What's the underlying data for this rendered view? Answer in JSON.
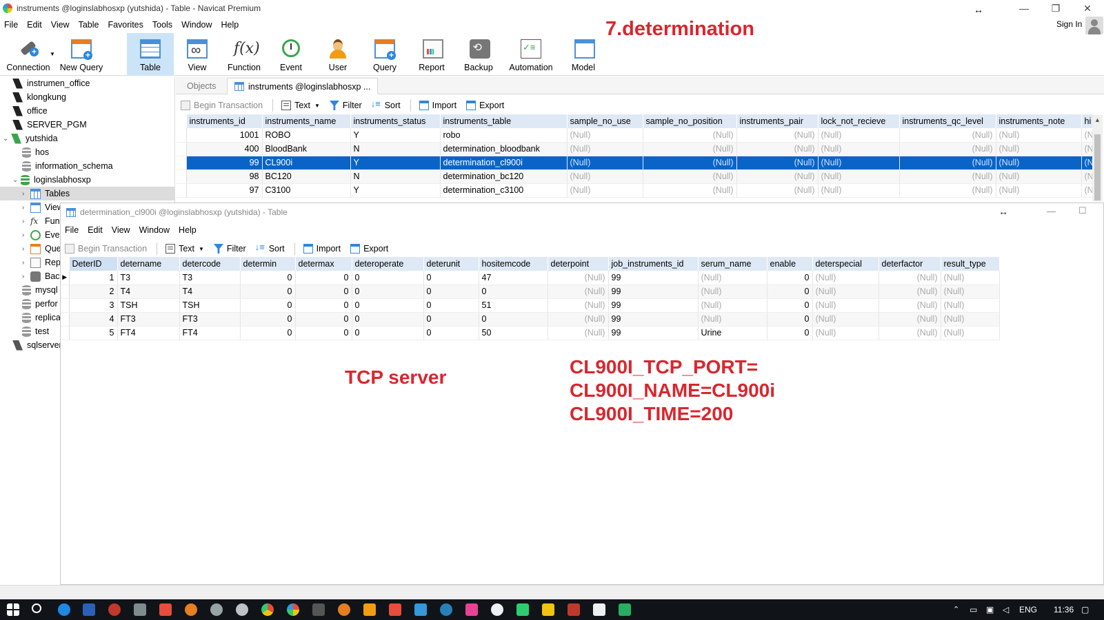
{
  "window": {
    "title": "instruments @loginslabhosxp (yutshida) - Table - Navicat Premium",
    "sign_in": "Sign In"
  },
  "menu": [
    "File",
    "Edit",
    "View",
    "Table",
    "Favorites",
    "Tools",
    "Window",
    "Help"
  ],
  "toolbar": {
    "items": [
      {
        "label": "Connection",
        "icon": "connection-icon"
      },
      {
        "label": "New Query",
        "icon": "new-query-icon"
      },
      {
        "label": "Table",
        "icon": "table-icon",
        "active": true
      },
      {
        "label": "View",
        "icon": "view-icon"
      },
      {
        "label": "Function",
        "icon": "function-icon"
      },
      {
        "label": "Event",
        "icon": "event-icon"
      },
      {
        "label": "User",
        "icon": "user-icon"
      },
      {
        "label": "Query",
        "icon": "query-icon"
      },
      {
        "label": "Report",
        "icon": "report-icon"
      },
      {
        "label": "Backup",
        "icon": "backup-icon"
      },
      {
        "label": "Automation",
        "icon": "automation-icon"
      },
      {
        "label": "Model",
        "icon": "model-icon"
      }
    ]
  },
  "sidebar": {
    "items": [
      {
        "label": "instrumen_office",
        "icon": "connection-icon"
      },
      {
        "label": "klongkung",
        "icon": "connection-icon"
      },
      {
        "label": "office",
        "icon": "connection-icon"
      },
      {
        "label": "SERVER_PGM",
        "icon": "connection-icon"
      },
      {
        "label": "yutshida",
        "icon": "connection-icon",
        "expanded": true
      },
      {
        "label": "hos",
        "icon": "database-icon"
      },
      {
        "label": "information_schema",
        "icon": "database-icon"
      },
      {
        "label": "loginslabhosxp",
        "icon": "database-icon",
        "expanded": true
      },
      {
        "label": "Tables",
        "icon": "table-icon",
        "selected": true
      },
      {
        "label": "View",
        "icon": "view-icon"
      },
      {
        "label": "Fun",
        "icon": "function-icon"
      },
      {
        "label": "Eve",
        "icon": "event-icon"
      },
      {
        "label": "Que",
        "icon": "query-icon"
      },
      {
        "label": "Rep",
        "icon": "report-icon"
      },
      {
        "label": "Bac",
        "icon": "backup-icon"
      },
      {
        "label": "mysql",
        "icon": "database-icon"
      },
      {
        "label": "perfor",
        "icon": "database-icon"
      },
      {
        "label": "replica",
        "icon": "database-icon"
      },
      {
        "label": "test",
        "icon": "database-icon"
      },
      {
        "label": "sqlserver",
        "icon": "connection-icon"
      }
    ]
  },
  "tabs": {
    "objects": "Objects",
    "active": "instruments @loginslabhosxp ..."
  },
  "subtoolbar": {
    "begin_transaction": "Begin Transaction",
    "text": "Text",
    "filter": "Filter",
    "sort": "Sort",
    "import": "Import",
    "export": "Export"
  },
  "instruments_table": {
    "columns": [
      "instruments_id",
      "instruments_name",
      "instruments_status",
      "instruments_table",
      "sample_no_use",
      "sample_no_position",
      "instruments_pair",
      "lock_not_recieve",
      "instruments_qc_level",
      "instruments_note",
      "hi"
    ],
    "rows": [
      [
        "1001",
        "ROBO",
        "Y",
        "robo",
        "(Null)",
        "(Null)",
        "(Null)",
        "(Null)",
        "(Null)",
        "(Null)",
        "(N"
      ],
      [
        "400",
        "BloodBank",
        "N",
        "determination_bloodbank",
        "(Null)",
        "(Null)",
        "(Null)",
        "(Null)",
        "(Null)",
        "(Null)",
        "(N"
      ],
      [
        "99",
        "CL900i",
        "Y",
        "determination_cl900i",
        "(Null)",
        "(Null)",
        "(Null)",
        "(Null)",
        "(Null)",
        "(Null)",
        "(N"
      ],
      [
        "98",
        "BC120",
        "N",
        "determination_bc120",
        "(Null)",
        "(Null)",
        "(Null)",
        "(Null)",
        "(Null)",
        "(Null)",
        "(N"
      ],
      [
        "97",
        "C3100",
        "Y",
        "determination_c3100",
        "(Null)",
        "(Null)",
        "(Null)",
        "(Null)",
        "(Null)",
        "(Null)",
        "(N"
      ]
    ]
  },
  "inner_window": {
    "title": "determination_cl900i @loginslabhosxp (yutshida) - Table",
    "menu": [
      "File",
      "Edit",
      "View",
      "Window",
      "Help"
    ]
  },
  "determination_table": {
    "columns": [
      "DeterID",
      "detername",
      "detercode",
      "determin",
      "determax",
      "deteroperate",
      "deterunit",
      "hositemcode",
      "deterpoint",
      "job_instruments_id",
      "serum_name",
      "enable",
      "deterspecial",
      "deterfactor",
      "result_type"
    ],
    "rows": [
      [
        "1",
        "T3",
        "T3",
        "0",
        "0",
        "0",
        "0",
        "47",
        "(Null)",
        "99",
        "(Null)",
        "0",
        "(Null)",
        "(Null)",
        "(Null)"
      ],
      [
        "2",
        "T4",
        "T4",
        "0",
        "0",
        "0",
        "0",
        "0",
        "(Null)",
        "99",
        "(Null)",
        "0",
        "(Null)",
        "(Null)",
        "(Null)"
      ],
      [
        "3",
        "TSH",
        "TSH",
        "0",
        "0",
        "0",
        "0",
        "51",
        "(Null)",
        "99",
        "(Null)",
        "0",
        "(Null)",
        "(Null)",
        "(Null)"
      ],
      [
        "4",
        "FT3",
        "FT3",
        "0",
        "0",
        "0",
        "0",
        "0",
        "(Null)",
        "99",
        "(Null)",
        "0",
        "(Null)",
        "(Null)",
        "(Null)"
      ],
      [
        "5",
        "FT4",
        "FT4",
        "0",
        "0",
        "0",
        "0",
        "50",
        "(Null)",
        "99",
        "Urine",
        "0",
        "(Null)",
        "(Null)",
        "(Null)"
      ]
    ]
  },
  "annotations": {
    "top": "7.determination",
    "tcp": "TCP server",
    "config": [
      "CL900I_TCP_PORT=",
      "CL900I_NAME=CL900i",
      "CL900I_TIME=200"
    ]
  },
  "taskbar": {
    "language": "ENG",
    "time": "11:36"
  },
  "colors": {
    "accent": "#0a64c8",
    "annotation": "#d9262e",
    "header": "#dfe9f5"
  }
}
